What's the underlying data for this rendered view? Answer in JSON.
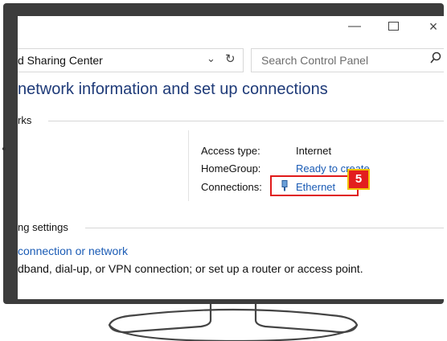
{
  "window": {
    "minimize_glyph": "—",
    "close_glyph": "×"
  },
  "address": {
    "path_text": "d Sharing Center",
    "search_placeholder": "Search Control Panel"
  },
  "page": {
    "title": "network information and set up connections"
  },
  "active_networks": {
    "section_label": "rks",
    "rows": [
      {
        "label": "Access type:",
        "value": "Internet"
      },
      {
        "label": "HomeGroup:",
        "value": "Ready to create"
      },
      {
        "label": "Connections:",
        "value": "Ethernet"
      }
    ]
  },
  "callout": {
    "number": "5"
  },
  "networking_settings": {
    "section_label": "ng settings",
    "link_text": "connection or network",
    "description": "dband, dial-up, or VPN connection; or set up a router or access point."
  },
  "colors": {
    "link": "#1a5bb5",
    "title": "#1e3a78",
    "callout_red": "#e31e1e",
    "callout_border": "#f2c200"
  }
}
